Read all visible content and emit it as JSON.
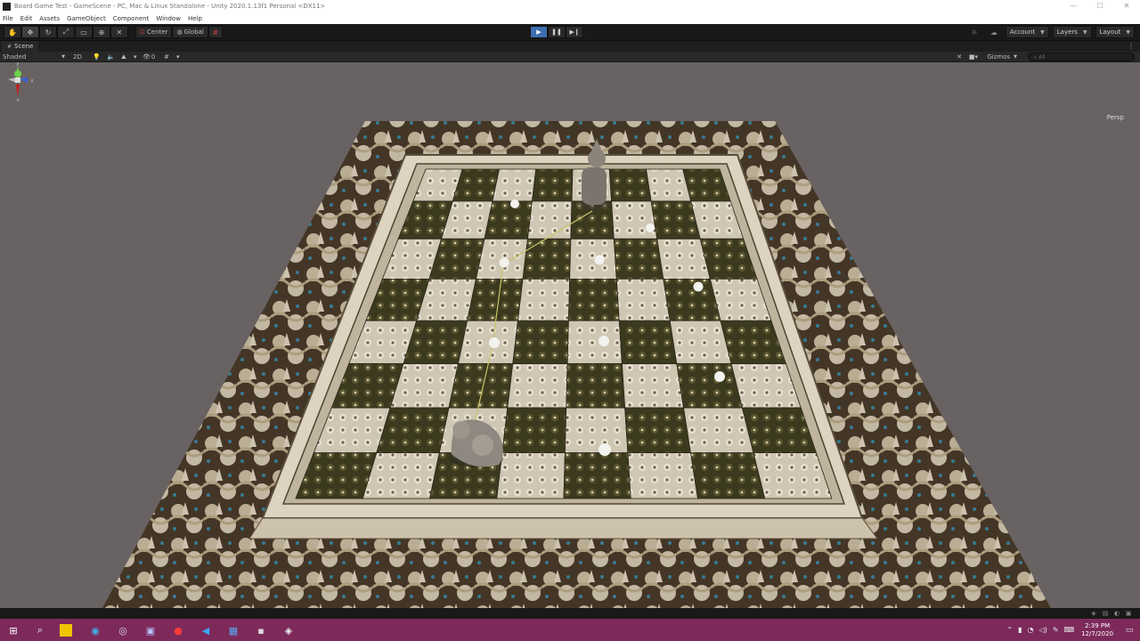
{
  "window": {
    "title": "Board Game Test - GameScene - PC, Mac & Linux Standalone - Unity 2020.1.13f1 Personal <DX11>",
    "minimize": "—",
    "maximize": "☐",
    "close": "✕"
  },
  "menu": [
    "File",
    "Edit",
    "Assets",
    "GameObject",
    "Component",
    "Window",
    "Help"
  ],
  "toolbar": {
    "tools": [
      "hand-tool-icon",
      "move-tool-icon",
      "rotate-tool-icon",
      "scale-tool-icon",
      "rect-tool-icon",
      "transform-tool-icon",
      "custom-tool-icon"
    ],
    "pivot_mode": "Center",
    "pivot_rotation": "Global",
    "account": "Account",
    "layers": "Layers",
    "layout": "Layout"
  },
  "scene_tab": {
    "label": "Scene"
  },
  "scene_toolbar": {
    "draw_mode": "Shaded",
    "mode_2d": "2D",
    "gizmos": "Gizmos",
    "search_placeholder": "All",
    "effects_count": "0"
  },
  "viewport": {
    "projection": "Persp",
    "gizmo_axes": {
      "y": "y",
      "x": "x",
      "z": "z"
    }
  },
  "taskbar": {
    "clock_time": "2:39 PM",
    "clock_date": "12/7/2020",
    "apps": [
      "windows-start-icon",
      "search-icon",
      "file-explorer-icon",
      "edge-icon",
      "steam-icon",
      "discord-icon",
      "youtube-music-icon",
      "vscode-icon",
      "trello-icon",
      "terminal-icon",
      "unity-icon"
    ]
  },
  "colors": {
    "accent_play": "#3d6fb0",
    "taskbar": "#7d2a5b",
    "viewport_bg": "#696262"
  }
}
